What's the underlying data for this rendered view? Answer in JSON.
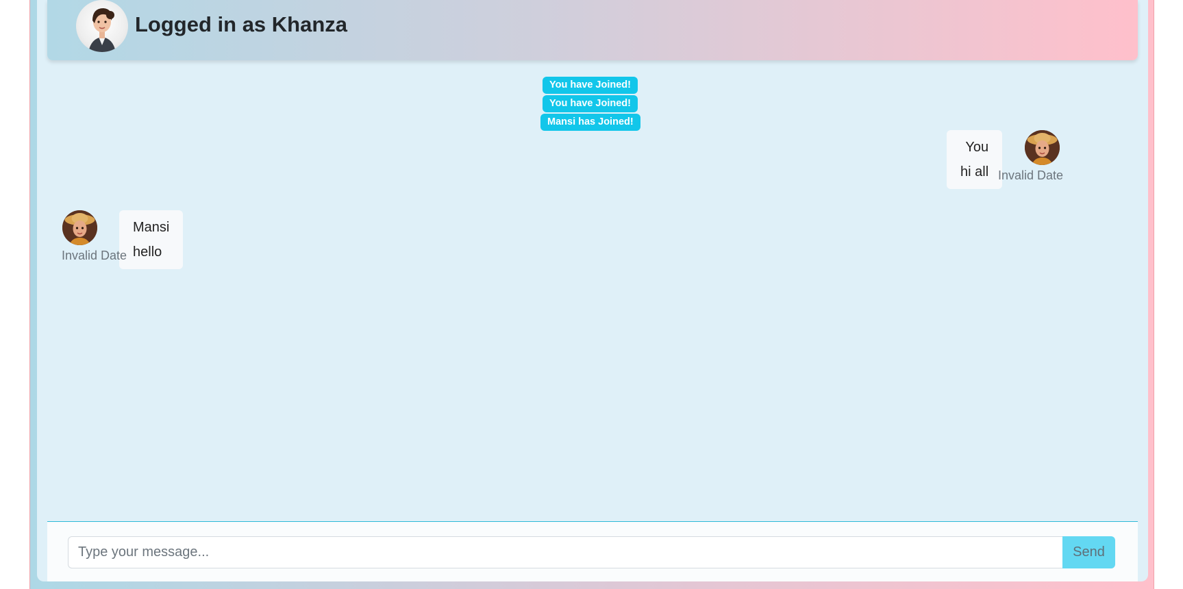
{
  "header": {
    "title": "Logged in as Khanza"
  },
  "notifications": [
    "You have Joined!",
    "You have Joined!",
    "Mansi has Joined!"
  ],
  "messages": [
    {
      "sender": "You",
      "text": "hi all",
      "date": "Invalid Date",
      "side": "right"
    },
    {
      "sender": "Mansi",
      "text": "hello",
      "date": "Invalid Date",
      "side": "left"
    }
  ],
  "composer": {
    "placeholder": "Type your message...",
    "value": "",
    "send_label": "Send"
  },
  "colors": {
    "notice": "#12c6ea",
    "send_button": "#63d8f2",
    "chat_background": "#dff0f8"
  }
}
